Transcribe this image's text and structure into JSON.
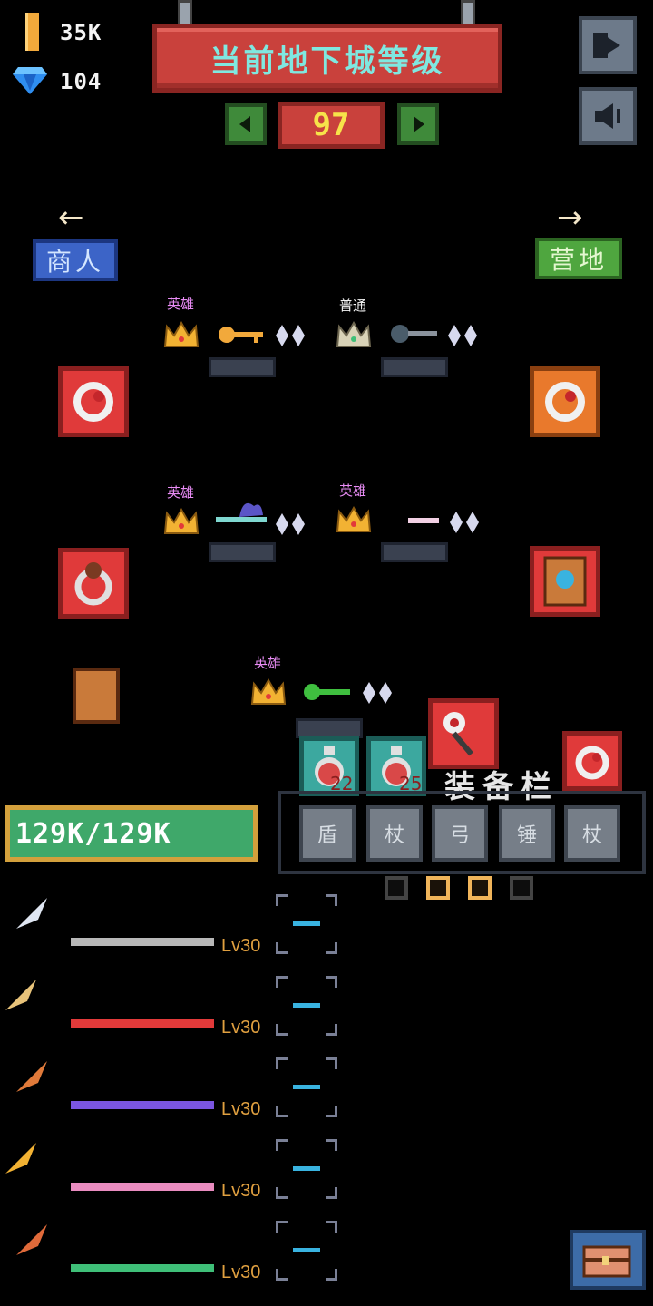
{
  "currency": {
    "gold": "35K",
    "gems": "104",
    "gold_icon": "gold-bar-icon",
    "gem_icon": "diamond-icon"
  },
  "dungeon": {
    "title": "当前地下城等级",
    "level": "97"
  },
  "nav": {
    "left_label": "商人",
    "right_label": "营地"
  },
  "rewards": [
    {
      "rarity": "英雄",
      "rarity_class": "hero"
    },
    {
      "rarity": "普通",
      "rarity_class": "normal"
    },
    {
      "rarity": "英雄",
      "rarity_class": "hero"
    },
    {
      "rarity": "英雄",
      "rarity_class": "hero"
    },
    {
      "rarity": "英雄",
      "rarity_class": "hero"
    }
  ],
  "potions": [
    {
      "count": "22"
    },
    {
      "count": "25"
    }
  ],
  "hp": {
    "text": "129K/129K"
  },
  "inventory": {
    "title": "装备栏",
    "slots": [
      "盾",
      "杖",
      "弓",
      "锤",
      "杖"
    ],
    "page_dots": [
      false,
      true,
      true,
      false
    ]
  },
  "skills": [
    {
      "level": "Lv30",
      "color": "#b8b8b8"
    },
    {
      "level": "Lv30",
      "color": "#e23a3a"
    },
    {
      "level": "Lv30",
      "color": "#7a55e0"
    },
    {
      "level": "Lv30",
      "color": "#e98cc0"
    },
    {
      "level": "Lv30",
      "color": "#3fbf78"
    }
  ],
  "colors": {
    "banner": "#c9413c",
    "level_text": "#f7e34a",
    "hp_bar": "#3fa86a",
    "hp_border": "#d3a03c"
  }
}
